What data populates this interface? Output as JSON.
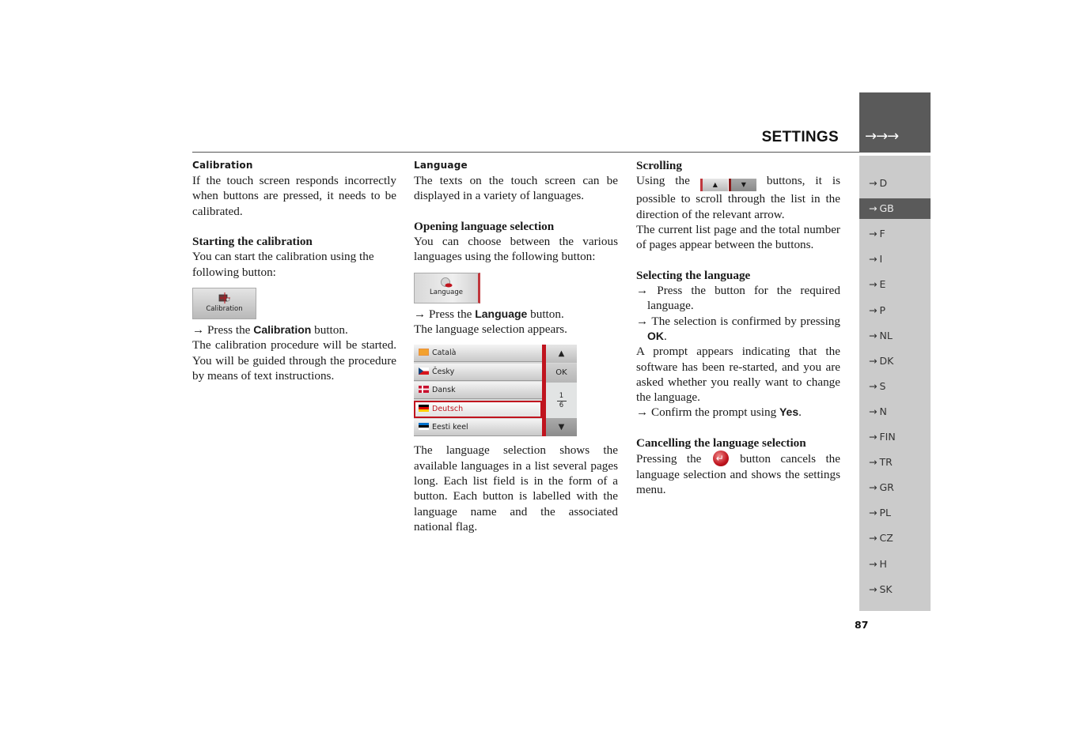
{
  "header": {
    "title": "SETTINGS",
    "arrows": "→→→"
  },
  "sidebar": {
    "arrow": "→",
    "active_index": 1,
    "items": [
      "D",
      "GB",
      "F",
      "I",
      "E",
      "P",
      "NL",
      "DK",
      "S",
      "N",
      "FIN",
      "TR",
      "GR",
      "PL",
      "CZ",
      "H",
      "SK"
    ]
  },
  "page_number": "87",
  "calibration": {
    "heading": "Calibration",
    "intro": "If the touch screen responds incorrectly when buttons are pressed, it needs to be calibrated.",
    "subheading": "Starting the calibration",
    "start_text": "You can start the calibration using the following button:",
    "button_caption": "Calibration",
    "step_prefix": "→ Press the ",
    "step_bold": "Calibration",
    "step_suffix": " button.",
    "outro": "The calibration procedure will be started. You will be guided through the procedure by means of text instructions."
  },
  "language": {
    "heading": "Language",
    "intro": "The texts on the touch screen can be displayed in a variety of languages.",
    "subheading": "Opening language selection",
    "open_text": "You can choose between the various languages using the following button:",
    "button_caption": "Language",
    "step_prefix": "→ Press the ",
    "step_bold": "Language",
    "step_suffix": " button.",
    "step_result": "The language selection appears.",
    "list": {
      "rows": [
        {
          "label": "Català",
          "flag": "catalan",
          "selected": false
        },
        {
          "label": "Česky",
          "flag": "czech",
          "selected": false
        },
        {
          "label": "Dansk",
          "flag": "danish",
          "selected": false
        },
        {
          "label": "Deutsch",
          "flag": "german",
          "selected": true
        },
        {
          "label": "Eesti keel",
          "flag": "estonian",
          "selected": false
        }
      ],
      "up_arrow": "▲",
      "ok_label": "OK",
      "page_current": "1",
      "page_total": "6",
      "down_arrow": "▼",
      "accent_color": "#c0141e"
    },
    "description": "The language selection shows the available languages in a list several pages long. Each list field is in the form of a button. Each button is labelled with the language name and the associated national flag."
  },
  "scrolling": {
    "heading": "Scrolling",
    "text_before": "Using the ",
    "up_arrow": "▲",
    "down_arrow": "▼",
    "text_after": " buttons, it is possible to scroll through the list in the direction of the relevant arrow.",
    "text2": "The current list page and the total number of pages appear between the buttons."
  },
  "selecting": {
    "heading": "Selecting the language",
    "step1": "→ Press the button for the required language.",
    "step2_prefix": "→ The selection is confirmed by pressing ",
    "step2_bold": "OK",
    "step2_suffix": ".",
    "prompt_text": "A prompt appears indicating that the software has been re-started, and you are asked whether you really want to change the language.",
    "step3_prefix": "→ Confirm the prompt using ",
    "step3_bold": "Yes",
    "step3_suffix": "."
  },
  "cancelling": {
    "heading": "Cancelling the language selection",
    "text_before": "Pressing the ",
    "text_after": " button cancels the language selection and shows the settings menu."
  }
}
